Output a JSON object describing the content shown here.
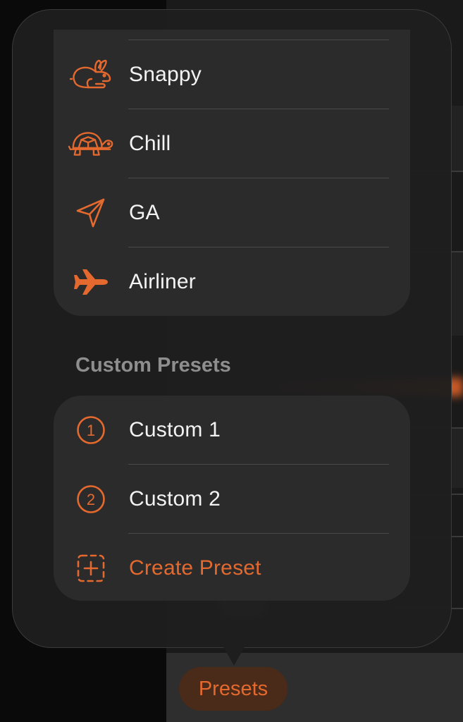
{
  "colors": {
    "accent": "#E4692E",
    "popover_bg": "#1E1E1E",
    "group_bg": "#2B2B2B",
    "text_primary": "#F3F3F3",
    "text_secondary": "#8E8E8E"
  },
  "presets_menu": {
    "builtin_items": [
      {
        "label": "Snappy",
        "icon": "rabbit-icon"
      },
      {
        "label": "Chill",
        "icon": "turtle-icon"
      },
      {
        "label": "GA",
        "icon": "paper-plane-icon"
      },
      {
        "label": "Airliner",
        "icon": "airplane-icon"
      }
    ],
    "custom_section": {
      "header": "Custom Presets",
      "items": [
        {
          "label": "Custom 1",
          "icon": "number-1-circle-icon"
        },
        {
          "label": "Custom 2",
          "icon": "number-2-circle-icon"
        }
      ],
      "create_label": "Create Preset",
      "create_icon": "dashed-plus-square-icon"
    }
  },
  "toolbar": {
    "presets_label": "Presets"
  }
}
